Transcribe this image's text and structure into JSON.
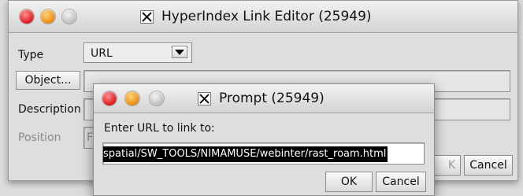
{
  "main_window": {
    "title": "HyperIndex Link Editor (25949)",
    "type_label": "Type",
    "type_value": "URL",
    "object_button": "Object...",
    "description_label": "Description",
    "position_label": "Position",
    "position_value_fragment": "F",
    "ok_fragment": "K",
    "cancel_button": "Cancel"
  },
  "prompt": {
    "title": "Prompt (25949)",
    "message": "Enter URL to link to:",
    "url_value": "spatial/SW_TOOLS/NIMAMUSE/webinter/rast_roam.html",
    "ok_button": "OK",
    "cancel_button": "Cancel"
  },
  "colors": {
    "close": "#d9161a",
    "minimize": "#e88a0a",
    "zoom": "#bdbdbd"
  }
}
